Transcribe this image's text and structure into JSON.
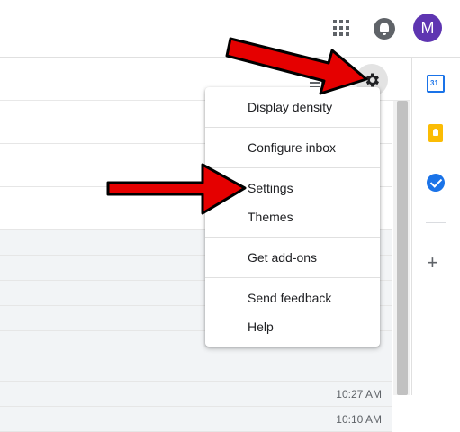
{
  "header": {
    "avatar_letter": "M",
    "apps_icon": "apps-grid-icon",
    "notifications_icon": "bell-icon"
  },
  "toolbar": {
    "density_icon": "density-icon",
    "settings_icon": "gear-icon"
  },
  "settings_menu": {
    "items": [
      {
        "label": "Display density"
      },
      {
        "label": "Configure inbox"
      },
      {
        "label": "Settings"
      },
      {
        "label": "Themes"
      },
      {
        "label": "Get add-ons"
      },
      {
        "label": "Send feedback"
      },
      {
        "label": "Help"
      }
    ]
  },
  "email_list": {
    "times": [
      "10:27 AM",
      "10:10 AM"
    ]
  },
  "side_panel": {
    "icons": [
      "calendar-icon",
      "keep-icon",
      "tasks-icon",
      "plus-icon"
    ],
    "calendar_label": "31"
  },
  "colors": {
    "avatar": "#5e35b1",
    "arrow": "#e50000",
    "calendar": "#1a73e8",
    "keep": "#fbbc04",
    "tasks": "#1a73e8"
  }
}
